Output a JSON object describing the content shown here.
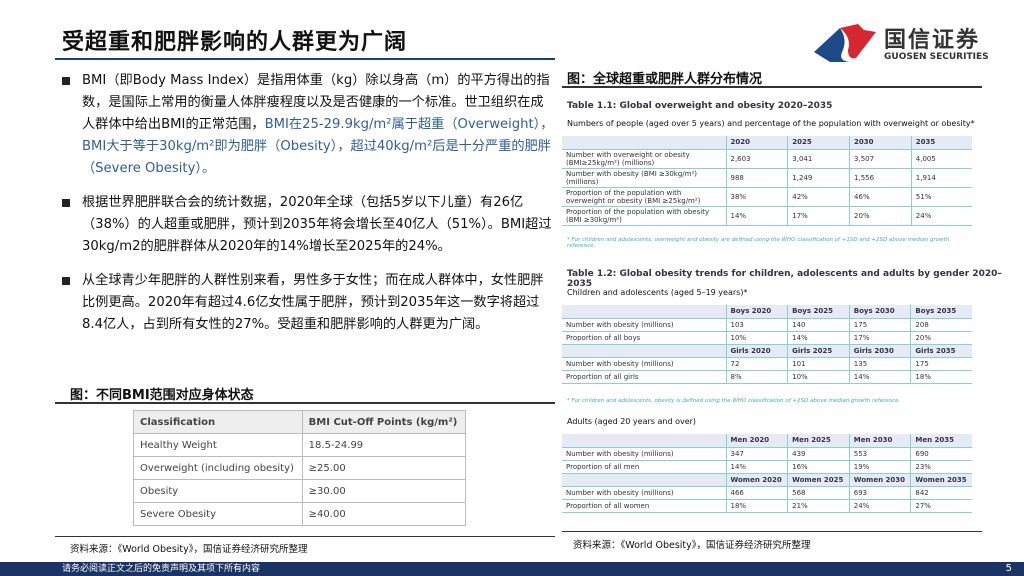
{
  "title": "受超重和肥胖影响的人群更为广阔",
  "logo": {
    "cn": "国信证券",
    "en": "GUOSEN SECURITIES"
  },
  "bullets": [
    {
      "text": "BMI（即Body Mass Index）是指用体重（kg）除以身高（m）的平方得出的指数，是国际上常用的衡量人体胖瘦程度以及是否健康的一个标准。世卫组织在成人群体中给出BMI的正常范围，",
      "highlight": "BMI在25-29.9kg/m²属于超重（Overweight），BMI大于等于30kg/m²即为肥胖（Obesity），超过40kg/m²后是十分严重的肥胖（Severe Obesity）。"
    },
    {
      "text": "根据世界肥胖联合会的统计数据，2020年全球（包括5岁以下儿童）有26亿（38%）的人超重或肥胖，预计到2035年将会增长至40亿人（51%）。BMI超过30kg/m2的肥胖群体从2020年的14%增长至2025年的24%。"
    },
    {
      "text": "从全球青少年肥胖的人群性别来看，男性多于女性；而在成人群体中，女性肥胖比例更高。2020年有超过4.6亿女性属于肥胖，预计到2035年这一数字将超过8.4亿人，占到所有女性的27%。受超重和肥胖影响的人群更为广阔。"
    }
  ],
  "left_fig": {
    "title": "图：不同BMI范围对应身体状态",
    "rows": [
      [
        "Classification",
        "BMI Cut-Off Points (kg/m²)"
      ],
      [
        "Healthy Weight",
        "18.5-24.99"
      ],
      [
        "Overweight (including obesity)",
        "≥25.00"
      ],
      [
        "Obesity",
        "≥30.00"
      ],
      [
        "Severe Obesity",
        "≥40.00"
      ]
    ],
    "source": "资料来源：《World Obesity》，国信证券经济研究所整理"
  },
  "right_fig": {
    "title": "图：全球超重或肥胖人群分布情况",
    "t1_title": "Table 1.1: Global overweight and obesity 2020–2035",
    "t1_sub": "Numbers of people (aged over 5 years) and percentage of the population with overweight or obesity*",
    "t1": [
      [
        "",
        "2020",
        "2025",
        "2030",
        "2035"
      ],
      [
        "Number with overweight or obesity (BMI≥25kg/m²) (millions)",
        "2,603",
        "3,041",
        "3,507",
        "4,005"
      ],
      [
        "Number with obesity (BMI ≥30kg/m²) (millions)",
        "988",
        "1,249",
        "1,556",
        "1,914"
      ],
      [
        "Proportion of the population with overweight or obesity (BMI ≥25kg/m²)",
        "38%",
        "42%",
        "46%",
        "51%"
      ],
      [
        "Proportion of the population with obesity (BMI ≥30kg/m²)",
        "14%",
        "17%",
        "20%",
        "24%"
      ]
    ],
    "t1_note": "* For children and adolescents, overweight and obesity are defined using the WHO classification of +1SD and +2SD above median growth reference.",
    "t2_title": "Table 1.2: Global obesity trends for children, adolescents and adults by gender 2020–2035",
    "t2_sub": "Children and adolescents (aged 5–19 years)*",
    "t2": [
      [
        "",
        "Boys 2020",
        "Boys 2025",
        "Boys 2030",
        "Boys 2035"
      ],
      [
        "Number with obesity (millions)",
        "103",
        "140",
        "175",
        "208"
      ],
      [
        "Proportion of all boys",
        "10%",
        "14%",
        "17%",
        "20%"
      ],
      [
        "",
        "Girls 2020",
        "Girls 2025",
        "Girls 2030",
        "Girls 2035"
      ],
      [
        "Number with obesity (millions)",
        "72",
        "101",
        "135",
        "175"
      ],
      [
        "Proportion of all girls",
        "8%",
        "10%",
        "14%",
        "18%"
      ]
    ],
    "t2_note": "* For children and adolescents, obesity is defined using the WHO classification of +2SD above median growth reference.",
    "t3_sub": "Adults (aged 20 years and over)",
    "t3": [
      [
        "",
        "Men 2020",
        "Men 2025",
        "Men 2030",
        "Men 2035"
      ],
      [
        "Number with obesity (millions)",
        "347",
        "439",
        "553",
        "690"
      ],
      [
        "Proportion of all men",
        "14%",
        "16%",
        "19%",
        "23%"
      ],
      [
        "",
        "Women 2020",
        "Women 2025",
        "Women 2030",
        "Women 2035"
      ],
      [
        "Number with obesity (millions)",
        "466",
        "568",
        "693",
        "842"
      ],
      [
        "Proportion of all women",
        "18%",
        "21%",
        "24%",
        "27%"
      ]
    ],
    "source": "资料来源：《World Obesity》，国信证券经济研究所整理"
  },
  "footer": "请务必阅读正文之后的免责声明及其项下所有内容",
  "page": "5"
}
